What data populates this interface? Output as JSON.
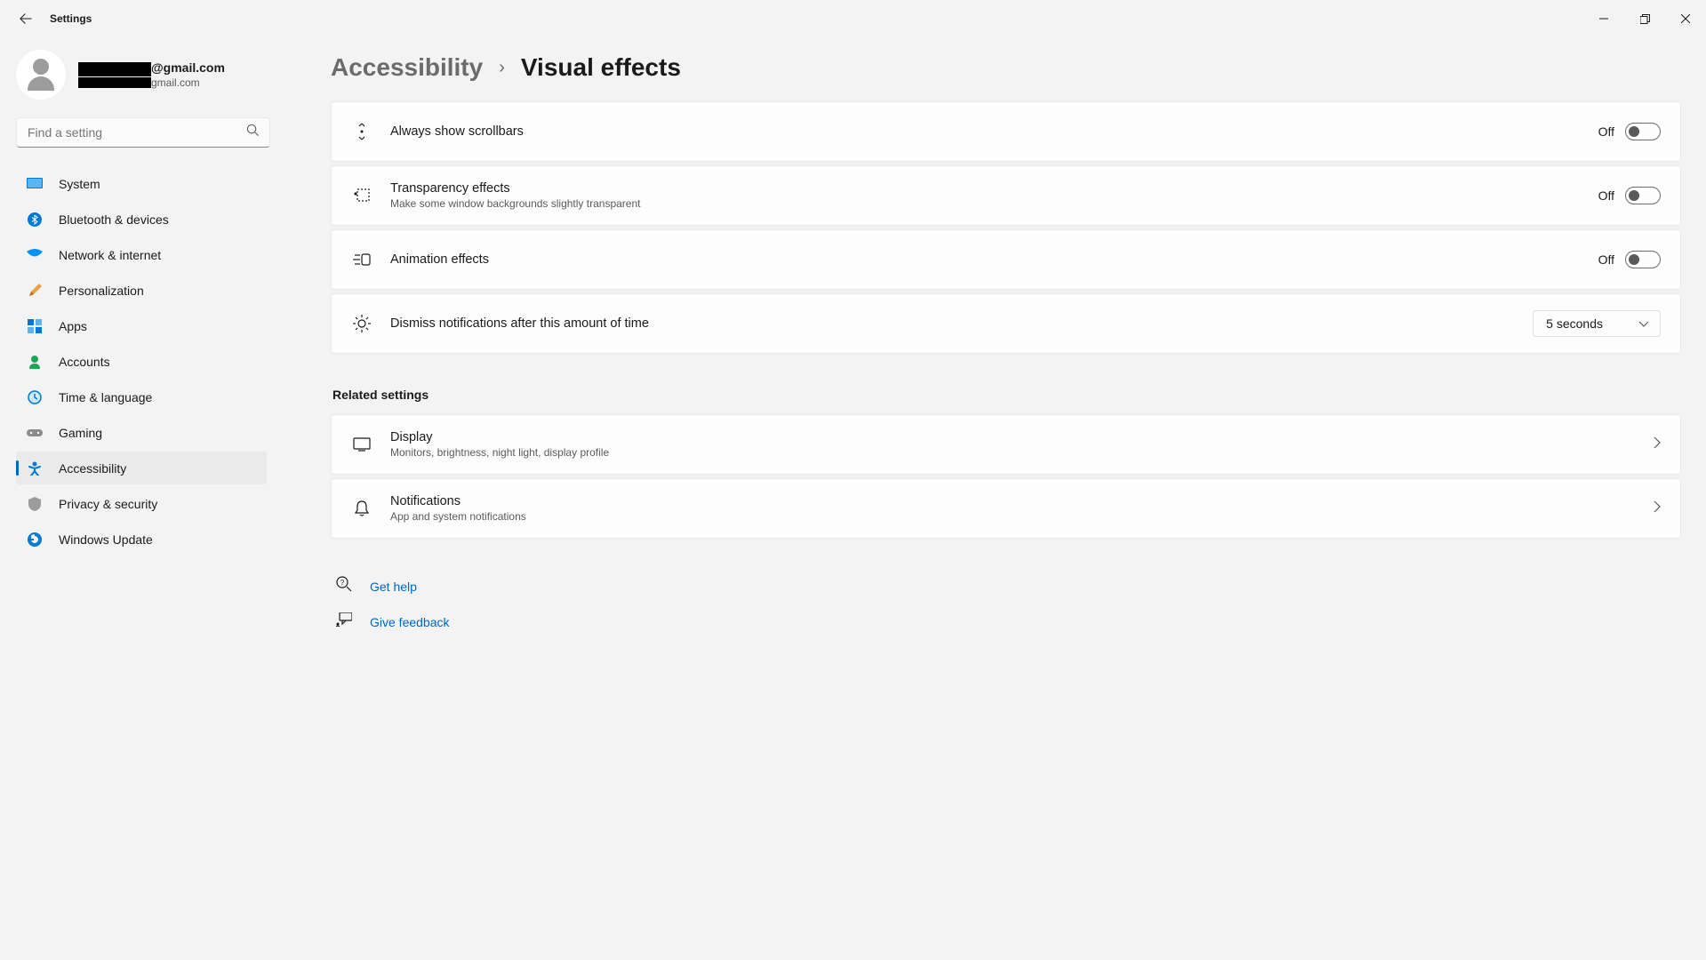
{
  "window": {
    "title": "Settings"
  },
  "user": {
    "name_suffix": "@gmail.com",
    "email_suffix": "gmail.com"
  },
  "search": {
    "placeholder": "Find a setting"
  },
  "nav": {
    "items": [
      {
        "label": "System"
      },
      {
        "label": "Bluetooth & devices"
      },
      {
        "label": "Network & internet"
      },
      {
        "label": "Personalization"
      },
      {
        "label": "Apps"
      },
      {
        "label": "Accounts"
      },
      {
        "label": "Time & language"
      },
      {
        "label": "Gaming"
      },
      {
        "label": "Accessibility"
      },
      {
        "label": "Privacy & security"
      },
      {
        "label": "Windows Update"
      }
    ]
  },
  "breadcrumb": {
    "parent": "Accessibility",
    "current": "Visual effects"
  },
  "settings": {
    "scrollbars": {
      "title": "Always show scrollbars",
      "state": "Off"
    },
    "transparency": {
      "title": "Transparency effects",
      "sub": "Make some window backgrounds slightly transparent",
      "state": "Off"
    },
    "animation": {
      "title": "Animation effects",
      "state": "Off"
    },
    "dismiss": {
      "title": "Dismiss notifications after this amount of time",
      "value": "5 seconds"
    }
  },
  "related": {
    "heading": "Related settings",
    "display": {
      "title": "Display",
      "sub": "Monitors, brightness, night light, display profile"
    },
    "notifications": {
      "title": "Notifications",
      "sub": "App and system notifications"
    }
  },
  "links": {
    "help": "Get help",
    "feedback": "Give feedback"
  }
}
